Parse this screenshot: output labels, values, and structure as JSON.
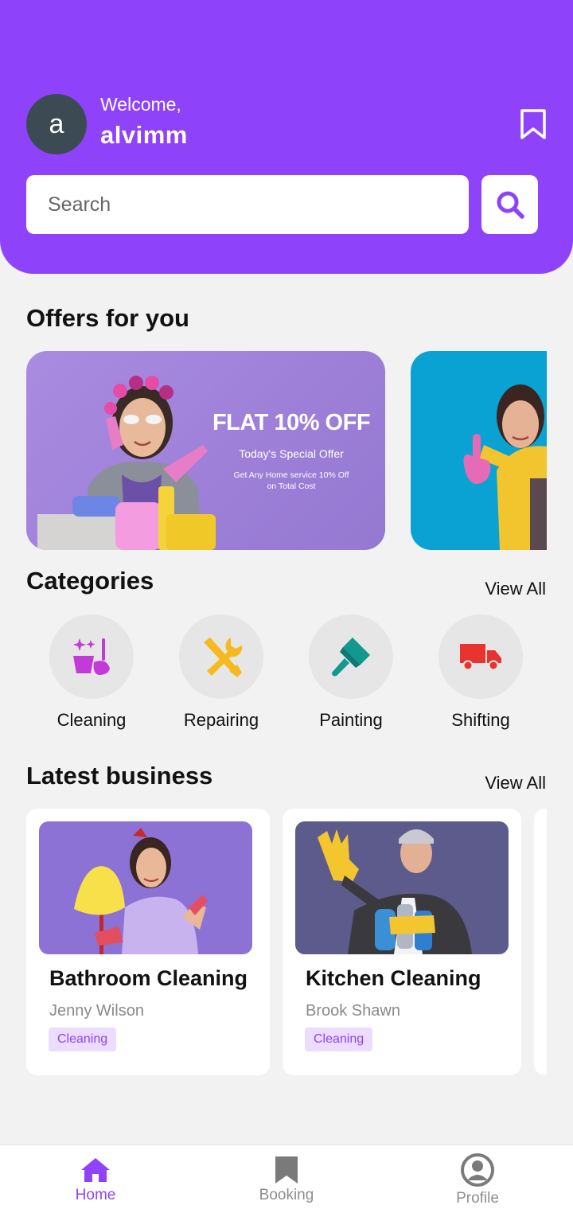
{
  "header": {
    "avatar_letter": "a",
    "welcome": "Welcome,",
    "username": "alvimm",
    "search_placeholder": "Search",
    "accent_color": "#8e43fb"
  },
  "offers": {
    "title": "Offers for you",
    "cards": [
      {
        "headline": "FLAT 10% OFF",
        "subtitle": "Today's Special Offer",
        "description_line1": "Get Any Home service 10% Off",
        "description_line2": "on Total Cost"
      }
    ]
  },
  "categories": {
    "title": "Categories",
    "view_all": "View All",
    "items": [
      {
        "label": "Cleaning",
        "icon": "cleaning-icon"
      },
      {
        "label": "Repairing",
        "icon": "wrench-screwdriver-icon"
      },
      {
        "label": "Painting",
        "icon": "paint-brush-icon"
      },
      {
        "label": "Shifting",
        "icon": "truck-icon"
      }
    ]
  },
  "latest_business": {
    "title": "Latest business",
    "view_all": "View All",
    "items": [
      {
        "title": "Bathroom Cleaning",
        "owner": "Jenny Wilson",
        "tag": "Cleaning"
      },
      {
        "title": "Kitchen Cleaning",
        "owner": "Brook Shawn",
        "tag": "Cleaning"
      }
    ]
  },
  "nav": {
    "items": [
      {
        "label": "Home",
        "icon": "home-icon",
        "active": true
      },
      {
        "label": "Booking",
        "icon": "bookmark-icon",
        "active": false
      },
      {
        "label": "Profile",
        "icon": "user-icon",
        "active": false
      }
    ]
  }
}
